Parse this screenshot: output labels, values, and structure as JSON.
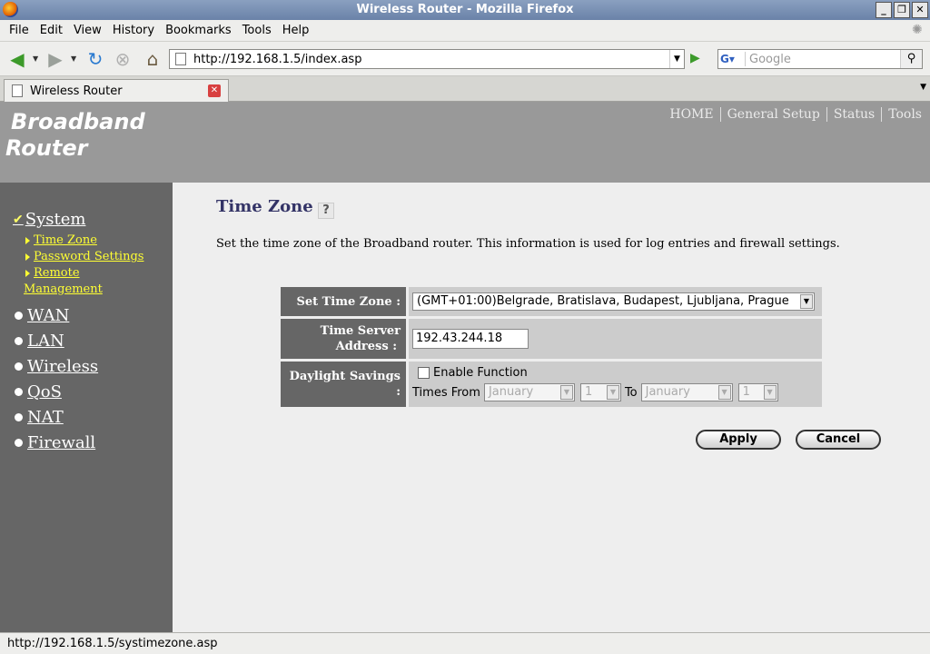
{
  "window": {
    "title": "Wireless Router - Mozilla Firefox"
  },
  "menu": [
    "File",
    "Edit",
    "View",
    "History",
    "Bookmarks",
    "Tools",
    "Help"
  ],
  "navbar": {
    "url": "http://192.168.1.5/index.asp",
    "search_engine": "G",
    "search_placeholder": "Google"
  },
  "tab": {
    "label": "Wireless Router"
  },
  "router": {
    "brand_line1": "Broadband",
    "brand_line2": "Router",
    "topnav": [
      "HOME",
      "General Setup",
      "Status",
      "Tools"
    ]
  },
  "sidebar": {
    "system": "System",
    "subitems": [
      "Time Zone",
      "Password Settings",
      "Remote",
      "Management"
    ],
    "items": [
      "WAN",
      "LAN",
      "Wireless",
      "QoS",
      "NAT",
      "Firewall"
    ]
  },
  "page": {
    "title": "Time Zone",
    "description": "Set the time zone of the Broadband router. This information is used for log entries and firewall settings.",
    "fields": {
      "timezone_label": "Set Time Zone :",
      "timezone_value": "(GMT+01:00)Belgrade, Bratislava, Budapest, Ljubljana, Prague",
      "server_label_1": "Time Server",
      "server_label_2": "Address :",
      "server_value": "192.43.244.18",
      "dst_label_1": "Daylight Savings",
      "dst_label_2": ":",
      "enable_label": "Enable Function",
      "times_from": "Times From",
      "to": "To",
      "from_month": "January",
      "from_day": "1",
      "to_month": "January",
      "to_day": "1"
    },
    "apply": "Apply",
    "cancel": "Cancel"
  },
  "status": {
    "text": "http://192.168.1.5/systimezone.asp"
  }
}
